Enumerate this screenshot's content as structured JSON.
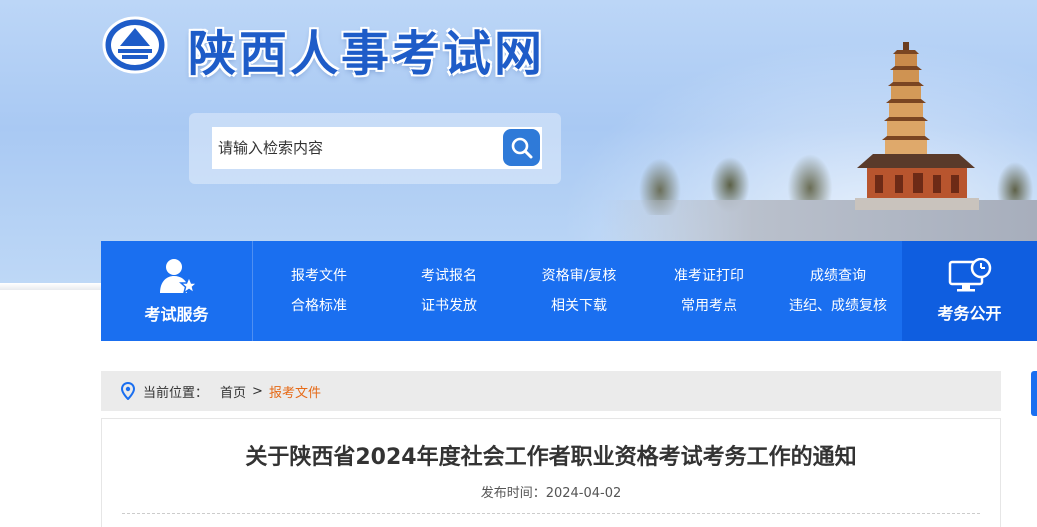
{
  "site": {
    "title": "陕西人事考试网"
  },
  "search": {
    "placeholder": "请输入检索内容"
  },
  "nav": {
    "service_label": "考试服务",
    "public_label": "考务公开",
    "links": [
      "报考文件",
      "考试报名",
      "资格审/复核",
      "准考证打印",
      "成绩查询",
      "合格标准",
      "证书发放",
      "相关下载",
      "常用考点",
      "违纪、成绩复核"
    ]
  },
  "breadcrumb": {
    "label": "当前位置：",
    "home": "首页",
    "separator": ">",
    "current": "报考文件"
  },
  "article": {
    "title": "关于陕西省2024年度社会工作者职业资格考试考务工作的通知",
    "date_label": "发布时间：",
    "date": "2024-04-02"
  },
  "colors": {
    "brand_blue": "#1a6ff0",
    "title_blue": "#1e5cc8",
    "breadcrumb_active": "#e66a17"
  },
  "icons": {
    "logo": "seal-logo-icon",
    "search": "magnifier-icon",
    "service": "user-star-icon",
    "public": "monitor-clock-icon",
    "location": "location-pin-icon"
  }
}
